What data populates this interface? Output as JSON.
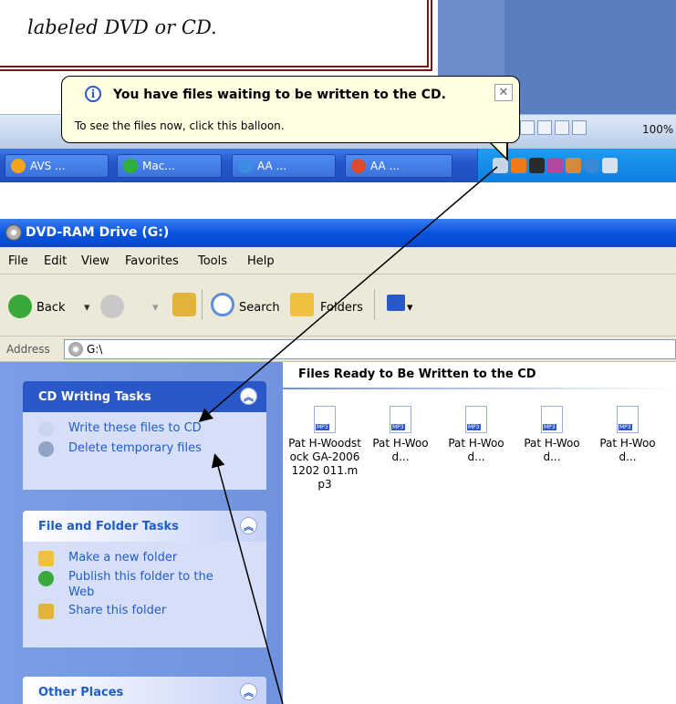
{
  "document": {
    "text": "labeled DVD or CD."
  },
  "balloon": {
    "title": "You have files waiting to be written to the CD.",
    "message": "To see the files now, click this balloon.",
    "close": "✕",
    "info": "i"
  },
  "office_status": {
    "zoom": "100%"
  },
  "taskbar": {
    "buttons": [
      {
        "label": "AVS ...",
        "color": "#f2a51a"
      },
      {
        "label": "Mac...",
        "color": "#2fae3a"
      },
      {
        "label": "AA ...",
        "color": "#3c8de3"
      },
      {
        "label": "AA ...",
        "color": "#e04a2a"
      }
    ]
  },
  "window": {
    "title": "DVD-RAM Drive (G:)",
    "menu": [
      "File",
      "Edit",
      "View",
      "Favorites",
      "Tools",
      "Help"
    ],
    "toolbar": {
      "back": "Back",
      "search": "Search",
      "folders": "Folders"
    },
    "address": {
      "label": "Address",
      "value": "G:\\"
    }
  },
  "sidebar": {
    "cd_tasks": {
      "title": "CD Writing Tasks",
      "items": [
        "Write these files to CD",
        "Delete temporary files"
      ]
    },
    "file_tasks": {
      "title": "File and Folder Tasks",
      "items": [
        "Make a new folder",
        "Publish this folder to the Web",
        "Share this folder"
      ]
    },
    "other_places": {
      "title": "Other Places"
    }
  },
  "files": {
    "group_title": "Files Ready to Be Written to the CD",
    "items": [
      "Pat H-Woodstock GA-20061202 011.mp3",
      "Pat H-Wood...",
      "Pat H-Wood...",
      "Pat H-Wood...",
      "Pat H-Wood..."
    ]
  },
  "colors": {
    "title_bar": "#0a55e0",
    "sidebar_bg": "#7a9ee5",
    "balloon_bg": "#ffffe1",
    "link": "#215dc6"
  }
}
